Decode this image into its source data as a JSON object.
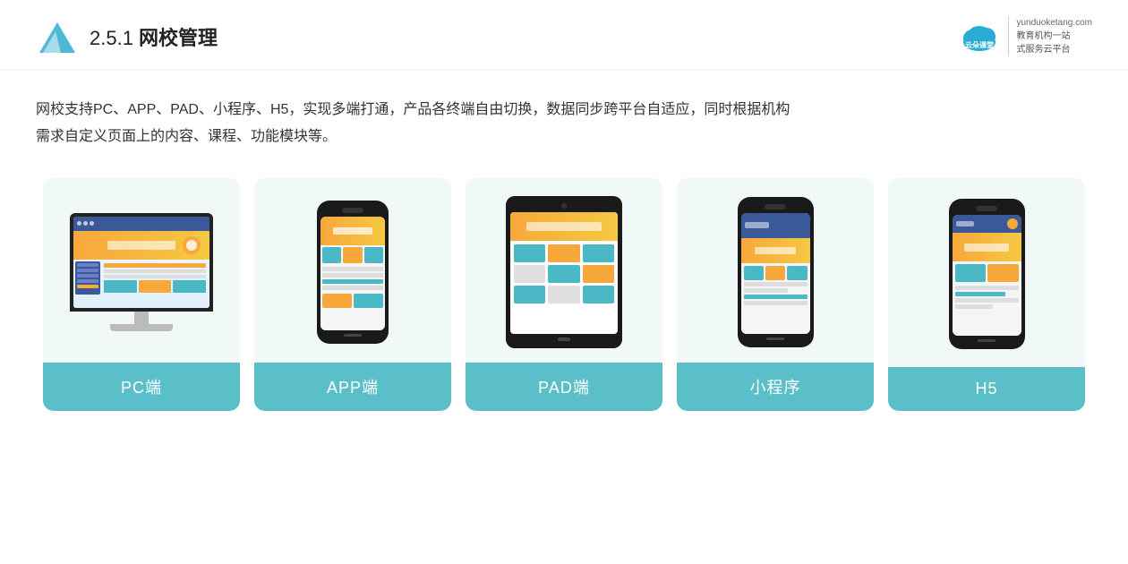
{
  "header": {
    "section_number": "2.5.1",
    "title_plain": "2.5.1 ",
    "title_bold": "网校管理",
    "brand_name": "云朵课堂",
    "brand_url": "yunduoketang.com",
    "brand_tagline_line1": "教育机构一站",
    "brand_tagline_line2": "式服务云平台"
  },
  "description": {
    "text_line1": "网校支持PC、APP、PAD、小程序、H5，实现多端打通，产品各终端自由切换，数据同步跨平台自适应，同时根据机构",
    "text_line2": "需求自定义页面上的内容、课程、功能模块等。"
  },
  "cards": [
    {
      "id": "pc",
      "label": "PC端",
      "device_type": "pc"
    },
    {
      "id": "app",
      "label": "APP端",
      "device_type": "phone"
    },
    {
      "id": "pad",
      "label": "PAD端",
      "device_type": "tablet"
    },
    {
      "id": "miniapp",
      "label": "小程序",
      "device_type": "phone"
    },
    {
      "id": "h5",
      "label": "H5",
      "device_type": "phone"
    }
  ],
  "colors": {
    "card_bg": "#edf6f8",
    "card_label_bg": "#5bbfca",
    "accent_orange": "#f7a83b",
    "accent_teal": "#4bb8c5",
    "text_dark": "#333333",
    "brand_blue": "#2a9fc9"
  }
}
